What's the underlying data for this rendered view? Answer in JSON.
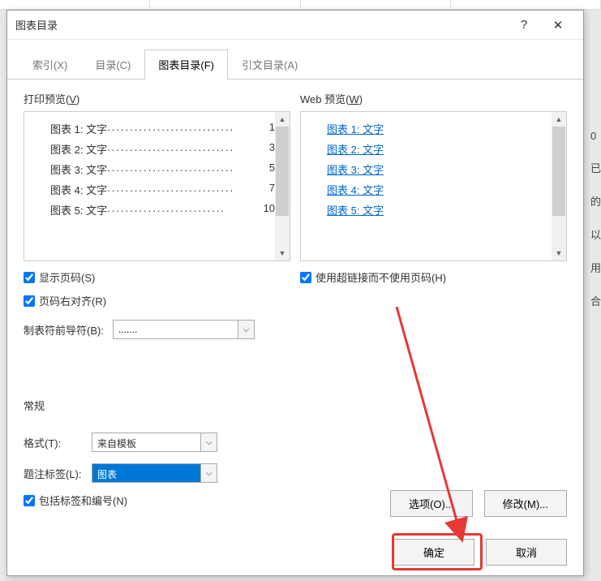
{
  "titlebar": {
    "title": "图表目录"
  },
  "tabs": {
    "index": "索引(X)",
    "toc": "目录(C)",
    "figures": "图表目录(F)",
    "citations": "引文目录(A)"
  },
  "print_preview": {
    "label_prefix": "打印预览(",
    "label_key": "V",
    "label_suffix": ")",
    "items": [
      {
        "text": "图表 1: 文字",
        "page": "1"
      },
      {
        "text": "图表 2: 文字",
        "page": "3"
      },
      {
        "text": "图表 3: 文字",
        "page": "5"
      },
      {
        "text": "图表 4: 文字",
        "page": "7"
      },
      {
        "text": "图表 5: 文字",
        "page": "10"
      }
    ]
  },
  "web_preview": {
    "label_prefix": "Web 预览(",
    "label_key": "W",
    "label_suffix": ")",
    "items": [
      "图表 1: 文字",
      "图表 2: 文字",
      "图表 3: 文字",
      "图表 4: 文字",
      "图表 5: 文字"
    ]
  },
  "checks": {
    "show_page": "显示页码(S)",
    "right_align": "页码右对齐(R)",
    "hyperlinks": "使用超链接而不使用页码(H)",
    "include_label": "包括标签和编号(N)"
  },
  "leader": {
    "label": "制表符前导符(B):",
    "value": "......."
  },
  "general": {
    "section": "常规",
    "format_label": "格式(T):",
    "format_value": "来自模板",
    "caption_label": "题注标签(L):",
    "caption_value": "图表"
  },
  "buttons": {
    "options": "选项(O)...",
    "modify": "修改(M)...",
    "ok": "确定",
    "cancel": "取消"
  },
  "obscured": [
    "0",
    "已",
    "的",
    "以",
    "用",
    "合"
  ]
}
